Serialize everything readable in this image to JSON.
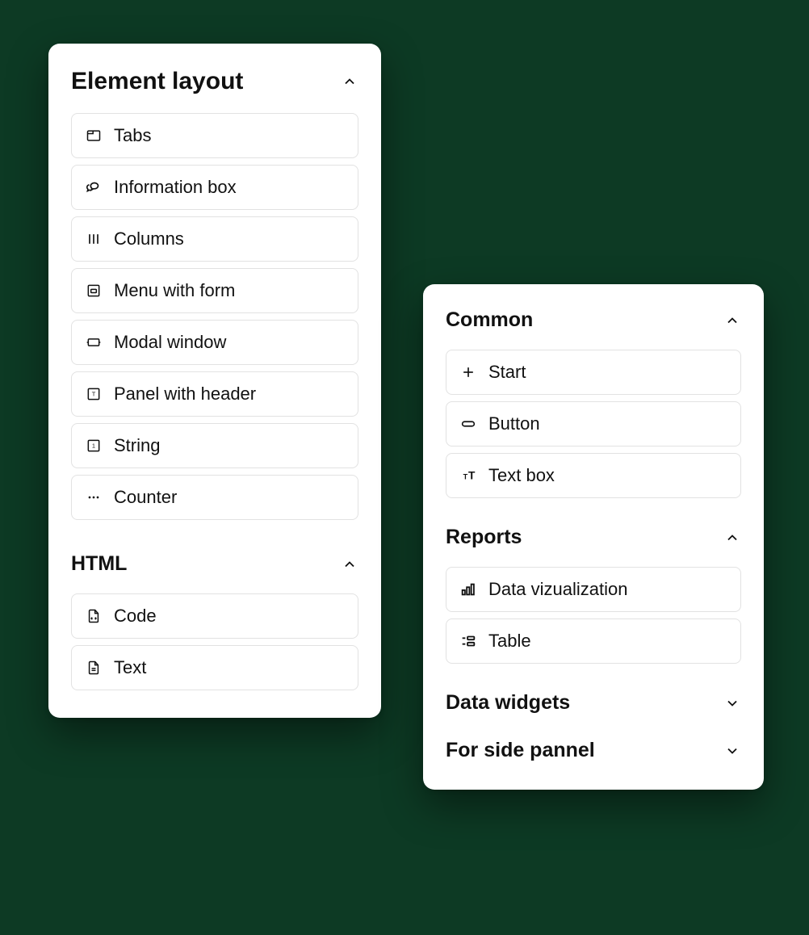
{
  "left": {
    "sections": [
      {
        "title": "Element layout",
        "expanded": true,
        "items": [
          {
            "icon": "tabs",
            "label": "Tabs"
          },
          {
            "icon": "info",
            "label": "Information box"
          },
          {
            "icon": "columns",
            "label": "Columns"
          },
          {
            "icon": "menuform",
            "label": "Menu with form"
          },
          {
            "icon": "modal",
            "label": "Modal window"
          },
          {
            "icon": "panelheader",
            "label": "Panel with header"
          },
          {
            "icon": "string",
            "label": "String"
          },
          {
            "icon": "counter",
            "label": "Counter"
          }
        ]
      },
      {
        "title": "HTML",
        "expanded": true,
        "items": [
          {
            "icon": "code",
            "label": "Code"
          },
          {
            "icon": "text",
            "label": "Text"
          }
        ]
      }
    ]
  },
  "right": {
    "sections": [
      {
        "title": "Common",
        "expanded": true,
        "items": [
          {
            "icon": "plus",
            "label": "Start"
          },
          {
            "icon": "button",
            "label": "Button"
          },
          {
            "icon": "textbox",
            "label": "Text box"
          }
        ]
      },
      {
        "title": "Reports",
        "expanded": true,
        "items": [
          {
            "icon": "chart",
            "label": "Data vizualization"
          },
          {
            "icon": "table",
            "label": "Table"
          }
        ]
      },
      {
        "title": "Data widgets",
        "expanded": false,
        "items": []
      },
      {
        "title": "For side pannel",
        "expanded": false,
        "items": []
      }
    ]
  }
}
